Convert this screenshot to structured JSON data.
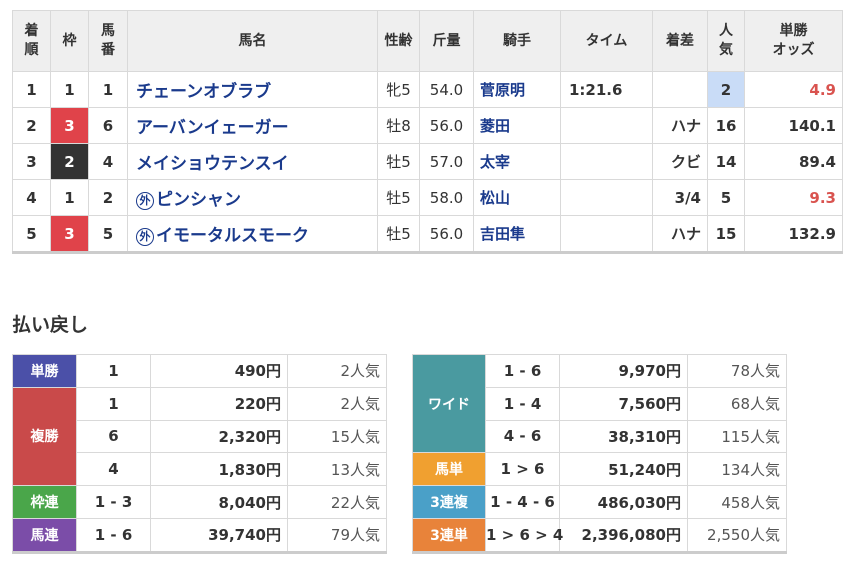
{
  "colors": {
    "frame3": "#e0434a",
    "frame2": "#333333",
    "win": "#4b50a8",
    "place": "#c94a4a",
    "bracket": "#4aa64a",
    "exacta_bracket": "#7b4da8",
    "wide": "#4a9aa0",
    "exacta": "#f0a030",
    "trio": "#4aa0c8",
    "trifecta": "#e8833a"
  },
  "results": {
    "headers": [
      "着\n順",
      "枠",
      "馬\n番",
      "馬名",
      "性齢",
      "斤量",
      "騎手",
      "タイム",
      "着差",
      "人\n気",
      "単勝\nオッズ"
    ],
    "rows": [
      {
        "pos": "1",
        "frame": "1",
        "num": "1",
        "gai": false,
        "gai_mark": "",
        "name": "チェーンオブラブ",
        "sexage": "牝5",
        "weight": "54.0",
        "jockey": "菅原明",
        "time": "1:21.6",
        "margin": "",
        "pop": "2",
        "odds": "4.9",
        "odds_red": true
      },
      {
        "pos": "2",
        "frame": "3",
        "num": "6",
        "gai": false,
        "gai_mark": "",
        "name": "アーバンイェーガー",
        "sexage": "牡8",
        "weight": "56.0",
        "jockey": "菱田",
        "time": "",
        "margin": "ハナ",
        "pop": "16",
        "odds": "140.1",
        "odds_red": false
      },
      {
        "pos": "3",
        "frame": "2",
        "num": "4",
        "gai": false,
        "gai_mark": "",
        "name": "メイショウテンスイ",
        "sexage": "牡5",
        "weight": "57.0",
        "jockey": "太宰",
        "time": "",
        "margin": "クビ",
        "pop": "14",
        "odds": "89.4",
        "odds_red": false
      },
      {
        "pos": "4",
        "frame": "1",
        "num": "2",
        "gai": true,
        "gai_mark": "外",
        "name": "ピンシャン",
        "sexage": "牡5",
        "weight": "58.0",
        "jockey": "松山",
        "time": "",
        "margin": "3/4",
        "pop": "5",
        "odds": "9.3",
        "odds_red": true
      },
      {
        "pos": "5",
        "frame": "3",
        "num": "5",
        "gai": true,
        "gai_mark": "外",
        "name": "イモータルスモーク",
        "sexage": "牡5",
        "weight": "56.0",
        "jockey": "吉田隼",
        "time": "",
        "margin": "ハナ",
        "pop": "15",
        "odds": "132.9",
        "odds_red": false
      }
    ]
  },
  "payout": {
    "title": "払い戻し",
    "left": [
      {
        "label": "単勝",
        "color": "#4b50a8",
        "rows": [
          {
            "combo": "1",
            "amount": "490円",
            "pop": "2人気"
          }
        ]
      },
      {
        "label": "複勝",
        "color": "#c94a4a",
        "rows": [
          {
            "combo": "1",
            "amount": "220円",
            "pop": "2人気"
          },
          {
            "combo": "6",
            "amount": "2,320円",
            "pop": "15人気"
          },
          {
            "combo": "4",
            "amount": "1,830円",
            "pop": "13人気"
          }
        ]
      },
      {
        "label": "枠連",
        "color": "#4aa64a",
        "rows": [
          {
            "combo": "1 - 3",
            "amount": "8,040円",
            "pop": "22人気"
          }
        ]
      },
      {
        "label": "馬連",
        "color": "#7b4da8",
        "rows": [
          {
            "combo": "1 - 6",
            "amount": "39,740円",
            "pop": "79人気"
          }
        ]
      }
    ],
    "right": [
      {
        "label": "ワイド",
        "color": "#4a9aa0",
        "rows": [
          {
            "combo": "1 - 6",
            "amount": "9,970円",
            "pop": "78人気"
          },
          {
            "combo": "1 - 4",
            "amount": "7,560円",
            "pop": "68人気"
          },
          {
            "combo": "4 - 6",
            "amount": "38,310円",
            "pop": "115人気"
          }
        ]
      },
      {
        "label": "馬単",
        "color": "#f0a030",
        "rows": [
          {
            "combo": "1 > 6",
            "amount": "51,240円",
            "pop": "134人気"
          }
        ]
      },
      {
        "label": "3連複",
        "color": "#4aa0c8",
        "rows": [
          {
            "combo": "1 - 4 - 6",
            "amount": "486,030円",
            "pop": "458人気"
          }
        ]
      },
      {
        "label": "3連単",
        "color": "#e8833a",
        "rows": [
          {
            "combo": "1 > 6 > 4",
            "amount": "2,396,080円",
            "pop": "2,550人気"
          }
        ]
      }
    ]
  }
}
